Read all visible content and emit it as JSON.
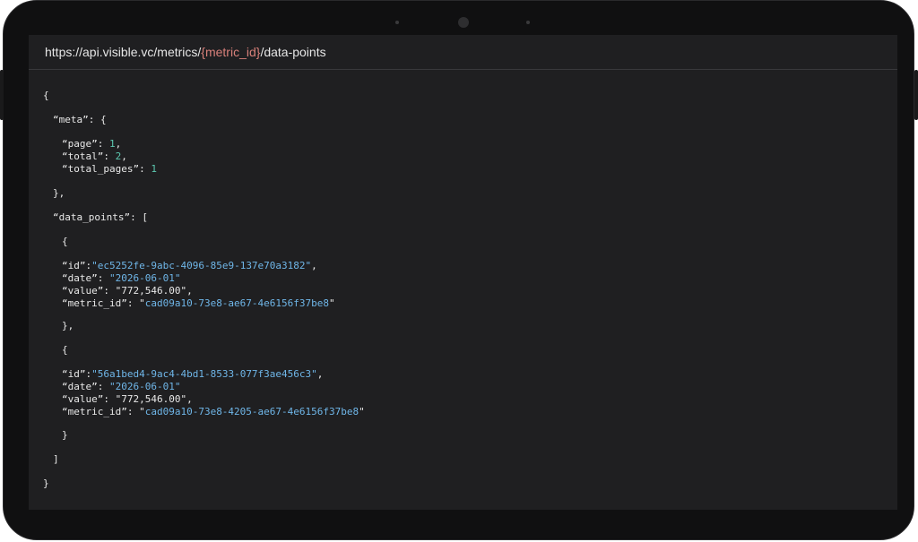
{
  "url": {
    "prefix": "https://api.visible.vc/metrics/",
    "param": "{metric_id}",
    "suffix": "/data-points"
  },
  "response": {
    "meta": {
      "page": "1",
      "total": "2",
      "total_pages": "1"
    },
    "data_points": [
      {
        "id": "ec5252fe-9abc-4096-85e9-137e70a3182",
        "date": "2026-06-01",
        "value": "772,546.00",
        "metric_id": "cad09a10-73e8-ae67-4e6156f37be8"
      },
      {
        "id": "56a1bed4-9ac4-4bd1-8533-077f3ae456c3",
        "date": "2026-06-01",
        "value": "772,546.00",
        "metric_id": "cad09a10-73e8-4205-ae67-4e6156f37be8"
      }
    ]
  },
  "colors": {
    "device": "#101011",
    "screen": "#1f1f21",
    "string": "#6fb6e8",
    "number": "#5cc8b0",
    "url_param": "#d8807a"
  }
}
